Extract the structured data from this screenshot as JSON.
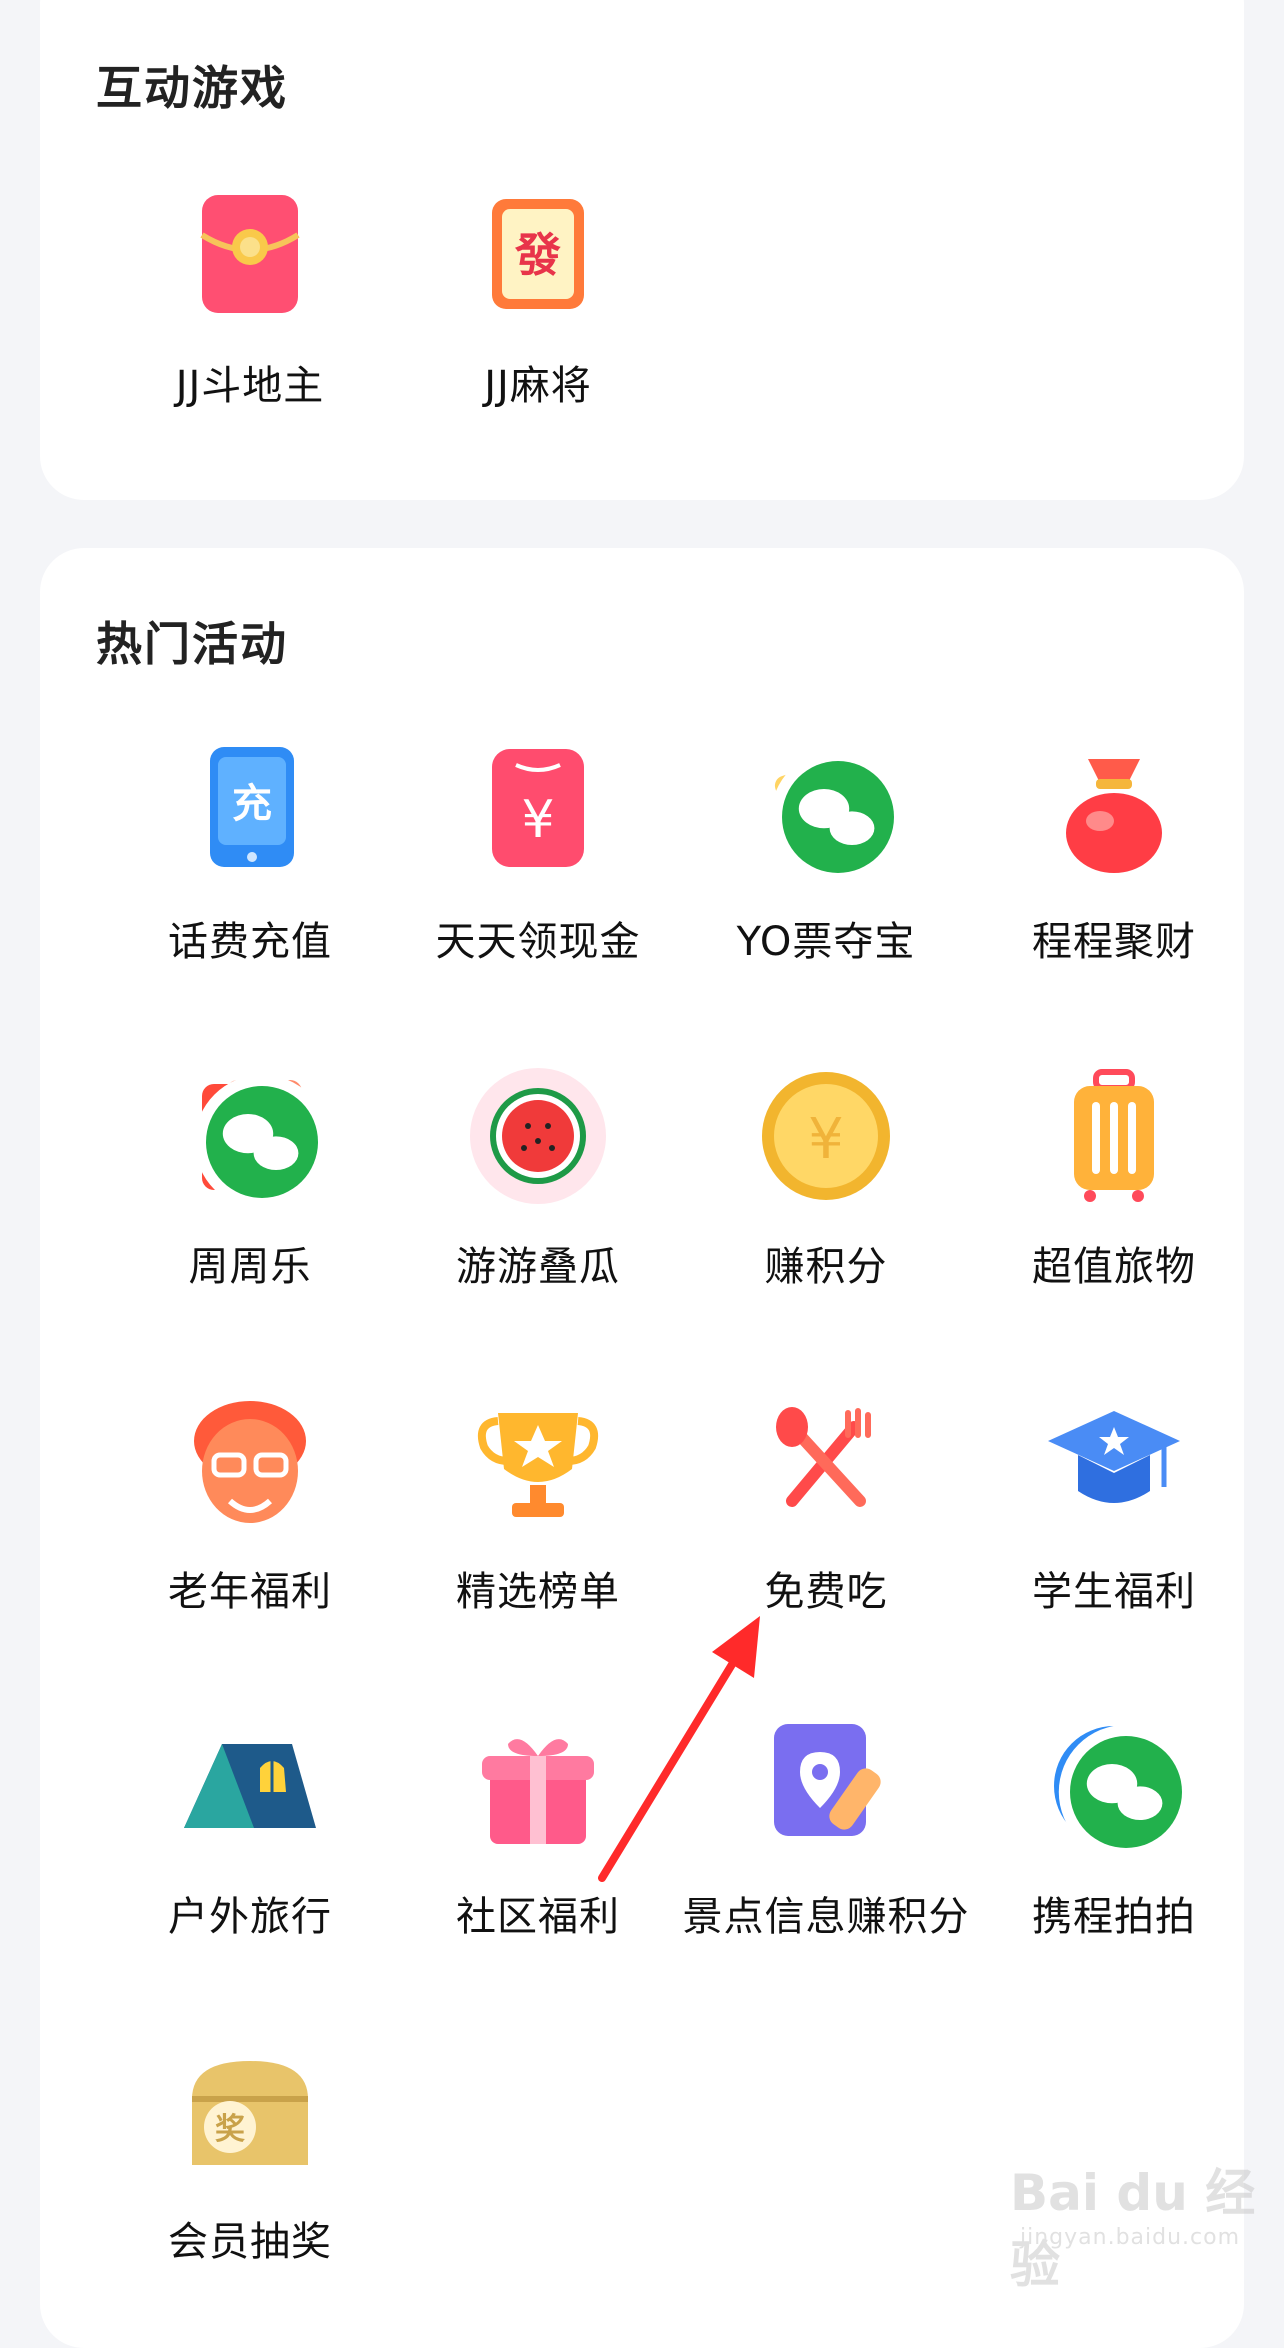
{
  "games": {
    "title": "互动游戏",
    "items": [
      {
        "label": "JJ斗地主",
        "icon": "red-envelope-coin-icon"
      },
      {
        "label": "JJ麻将",
        "icon": "mahjong-fa-tile-icon"
      }
    ]
  },
  "hot": {
    "title": "热门活动",
    "items": [
      {
        "label": "话费充值",
        "icon": "phone-recharge-icon"
      },
      {
        "label": "天天领现金",
        "icon": "cash-envelope-yen-icon"
      },
      {
        "label": "YO票夺宝",
        "icon": "gold-ticket-icon",
        "wechat_badge": true
      },
      {
        "label": "程程聚财",
        "icon": "money-bag-icon"
      },
      {
        "label": "周周乐",
        "icon": "question-card-icon",
        "wechat_badge": true
      },
      {
        "label": "游游叠瓜",
        "icon": "watermelon-icon"
      },
      {
        "label": "赚积分",
        "icon": "gold-coin-icon"
      },
      {
        "label": "超值旅物",
        "icon": "suitcase-icon"
      },
      {
        "label": "老年福利",
        "icon": "elder-face-icon"
      },
      {
        "label": "精选榜单",
        "icon": "trophy-icon"
      },
      {
        "label": "免费吃",
        "icon": "fork-spoon-icon"
      },
      {
        "label": "学生福利",
        "icon": "graduation-cap-icon"
      },
      {
        "label": "户外旅行",
        "icon": "tent-icon"
      },
      {
        "label": "社区福利",
        "icon": "gift-box-icon"
      },
      {
        "label": "景点信息赚积分",
        "icon": "map-pin-pencil-icon"
      },
      {
        "label": "携程拍拍",
        "icon": "camera-icon",
        "wechat_badge": true
      },
      {
        "label": "会员抽奖",
        "icon": "prize-chest-icon"
      }
    ]
  },
  "annotation": {
    "color": "#ff2a2a",
    "icon": "red-arrow-annotation"
  },
  "watermark": {
    "brand": "Bai du 经验",
    "url": "jingyan.baidu.com"
  }
}
